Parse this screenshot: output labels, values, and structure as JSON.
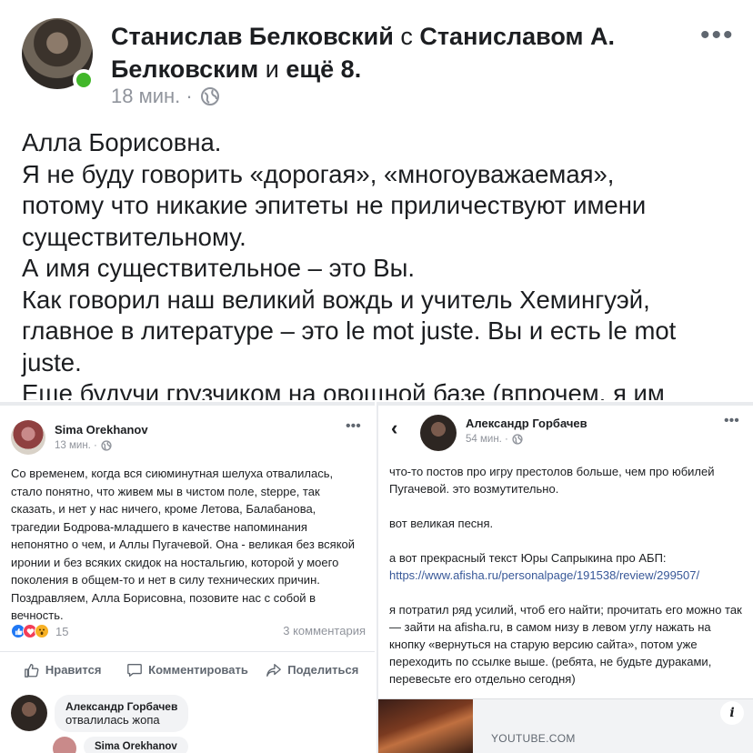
{
  "top_post": {
    "author_line1_bold": "Станислав Белковский",
    "author_line1_plain": " с ",
    "author_line1_bold2": "Станиславом А.",
    "author_line2_bold": "Белковским",
    "author_line2_plain": " и ",
    "author_line2_bold2": "ещё 8.",
    "time": "18 мин. ·",
    "privacy_icon": "globe-icon",
    "more": "•••",
    "lines": [
      "Алла Борисовна.",
      "Я не буду говорить «дорогая», «многоуважаемая»,",
      "потому что никакие эпитеты не приличествуют имени",
      "существительному.",
      "А имя существительное – это Вы.",
      "Как говорил наш великий вождь и учитель Хемингуэй,",
      "главное в литературе – это le mot juste. Вы и есть le mot",
      "juste.",
      "Еще будучи грузчиком на овощной базе (впрочем, я им"
    ]
  },
  "left_post": {
    "author": "Sima Orekhanov",
    "time": "13 мин. ·",
    "more": "•••",
    "text": "Со временем, когда вся сиюминутная шелуха отвалилась, стало понятно, что живем мы в чистом поле, steppe, так сказать, и нет у нас ничего, кроме Летова, Балабанова, трагедии Бодрова-младшего в качестве напоминания непонятно о чем, и Аллы Пугачевой. Она - великая без всякой иронии и без всяких скидок на ностальгию, которой у моего поколения в общем-то и нет в силу технических причин. Поздравляем, Алла Борисовна, позовите нас с собой в вечность.",
    "reaction_count": "15",
    "comments_count": "3 комментария",
    "actions": {
      "like": "Нравится",
      "comment": "Комментировать",
      "share": "Поделиться"
    },
    "comment": {
      "author": "Александр Горбачев",
      "text": "отвалилась жопа"
    },
    "reply": {
      "author": "Sima Orekhanov"
    }
  },
  "right_post": {
    "back": "‹",
    "author": "Александр Горбачев",
    "time": "54 мин. ·",
    "more": "•••",
    "para1": "что-то постов про игру престолов больше, чем про юбилей Пугачевой. это возмутительно.",
    "para2": "вот великая песня.",
    "para3_text": "а вот прекрасный текст Юры Сапрыкина про АБП:",
    "para3_link": "https://www.afisha.ru/personalpage/191538/review/299507/",
    "para4": "я потратил ряд усилий, чтоб его найти; прочитать его можно так — зайти на afisha.ru, в самом низу в левом углу нажать на кнопку «вернуться на старую версию сайта», потом уже переходить по ссылке выше. (ребята, не будьте дураками, перевесьте его отдельно сегодня)",
    "link_domain": "YOUTUBE.COM",
    "info": "i"
  }
}
